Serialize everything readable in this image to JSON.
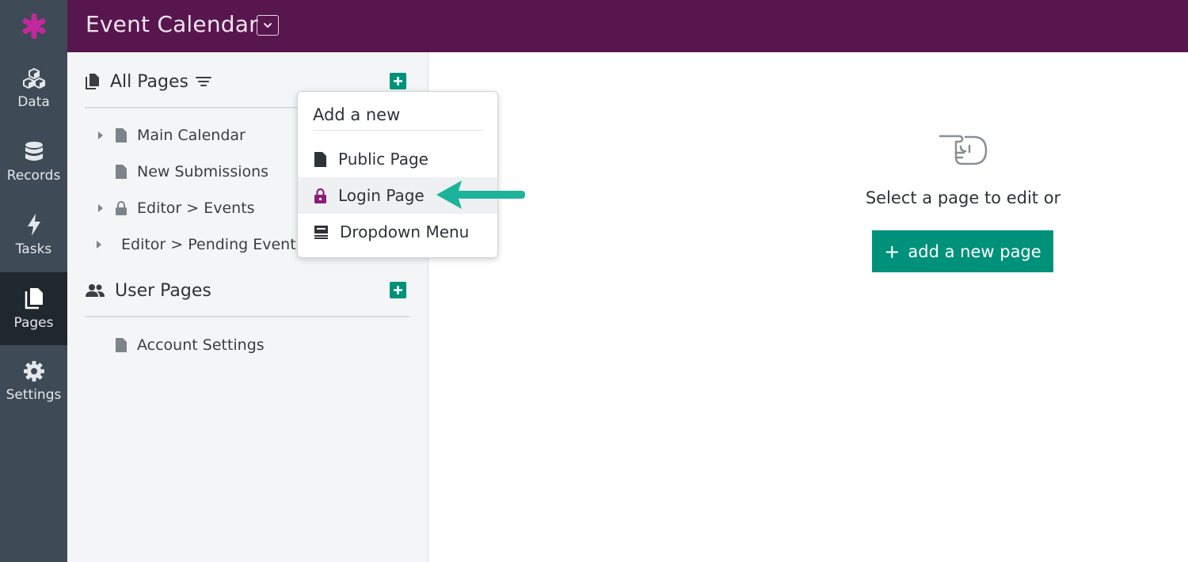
{
  "app": {
    "title": "Event Calendar"
  },
  "nav": {
    "items": [
      {
        "label": "Data"
      },
      {
        "label": "Records"
      },
      {
        "label": "Tasks"
      },
      {
        "label": "Pages",
        "active": true
      },
      {
        "label": "Settings"
      }
    ]
  },
  "pages_panel": {
    "all_pages": {
      "title": "All Pages",
      "items": [
        {
          "label": "Main Calendar",
          "icon": "page-icon",
          "expandable": true
        },
        {
          "label": "New Submissions",
          "icon": "page-icon",
          "expandable": false
        },
        {
          "label": "Editor > Events",
          "icon": "lock-icon",
          "expandable": true
        },
        {
          "label": "Editor > Pending Events",
          "icon": "lock-icon",
          "expandable": true
        }
      ]
    },
    "user_pages": {
      "title": "User Pages",
      "items": [
        {
          "label": "Account Settings",
          "icon": "page-icon"
        }
      ]
    }
  },
  "add_menu": {
    "title": "Add a new",
    "items": [
      {
        "label": "Public Page",
        "icon": "page-icon"
      },
      {
        "label": "Login Page",
        "icon": "lock-icon",
        "highlighted": true
      },
      {
        "label": "Dropdown Menu",
        "icon": "menu-icon"
      }
    ]
  },
  "main": {
    "empty_text": "Select a page to edit or",
    "add_button_label": "add a new page"
  },
  "colors": {
    "topbar": "#58164e",
    "nav_bg": "#3e4a55",
    "nav_active": "#1f272f",
    "accent_green": "#00917a",
    "arrow_teal": "#1db39a",
    "lock_purple": "#8a1e7a",
    "logo_pink": "#c2289c"
  }
}
